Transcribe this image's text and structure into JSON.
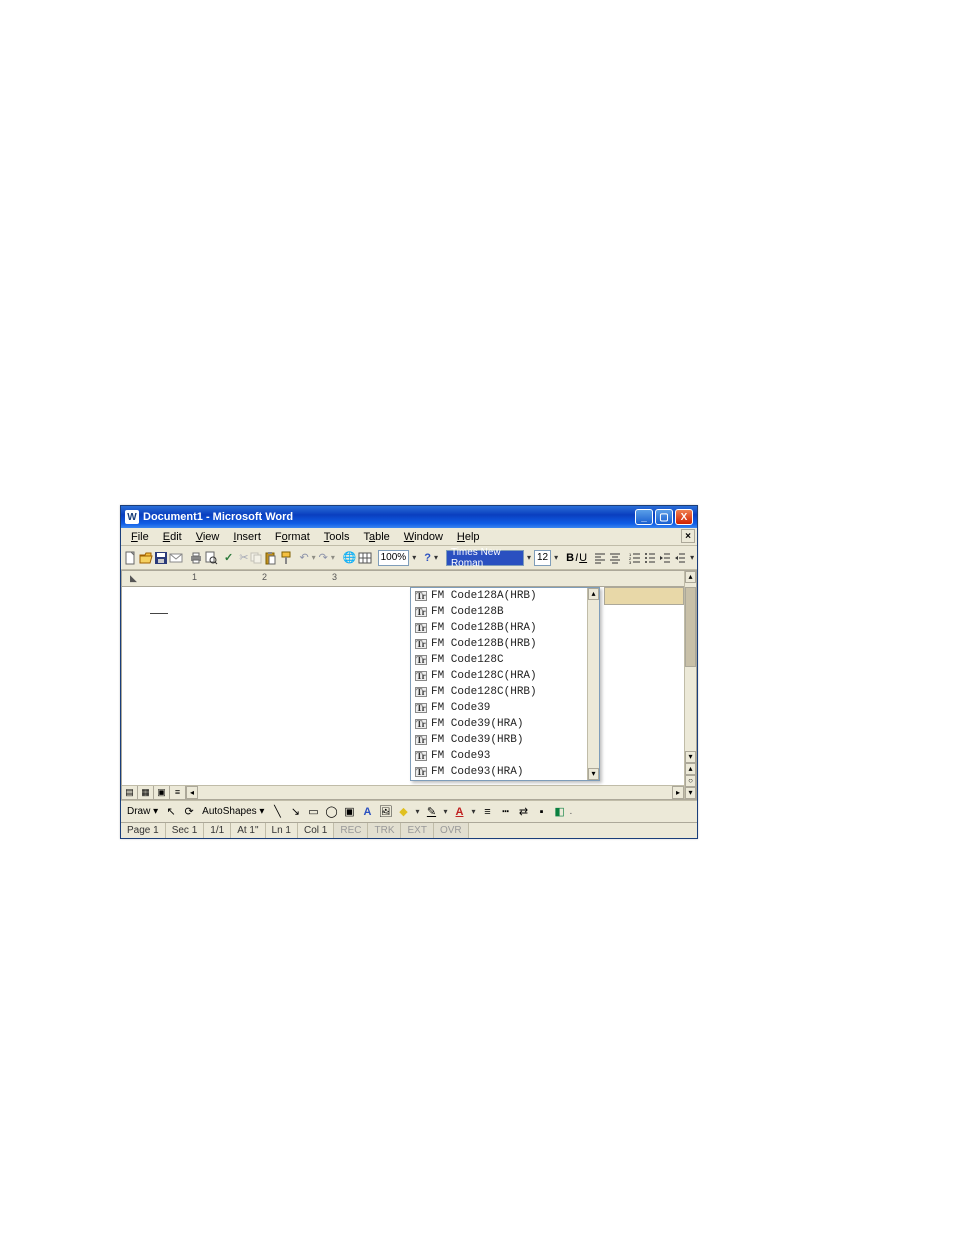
{
  "window": {
    "title": "Document1 - Microsoft Word"
  },
  "menus": {
    "file": "File",
    "edit": "Edit",
    "view": "View",
    "insert": "Insert",
    "format": "Format",
    "tools": "Tools",
    "table": "Table",
    "window": "Window",
    "help": "Help"
  },
  "toolbar": {
    "zoom": "100%",
    "font_name": "Times New Roman",
    "font_size": "12"
  },
  "font_dropdown": {
    "items": [
      "FM Code128A(HRB)",
      "FM Code128B",
      "FM Code128B(HRA)",
      "FM Code128B(HRB)",
      "FM Code128C",
      "FM Code128C(HRA)",
      "FM Code128C(HRB)",
      "FM Code39",
      "FM Code39(HRA)",
      "FM Code39(HRB)",
      "FM Code93",
      "FM Code93(HRA)"
    ]
  },
  "drawbar": {
    "draw": "Draw",
    "autoshapes": "AutoShapes"
  },
  "status": {
    "page": "Page 1",
    "sec": "Sec 1",
    "pages": "1/1",
    "at": "At 1\"",
    "ln": "Ln 1",
    "col": "Col 1",
    "rec": "REC",
    "trk": "TRK",
    "ext": "EXT",
    "ovr": "OVR"
  }
}
